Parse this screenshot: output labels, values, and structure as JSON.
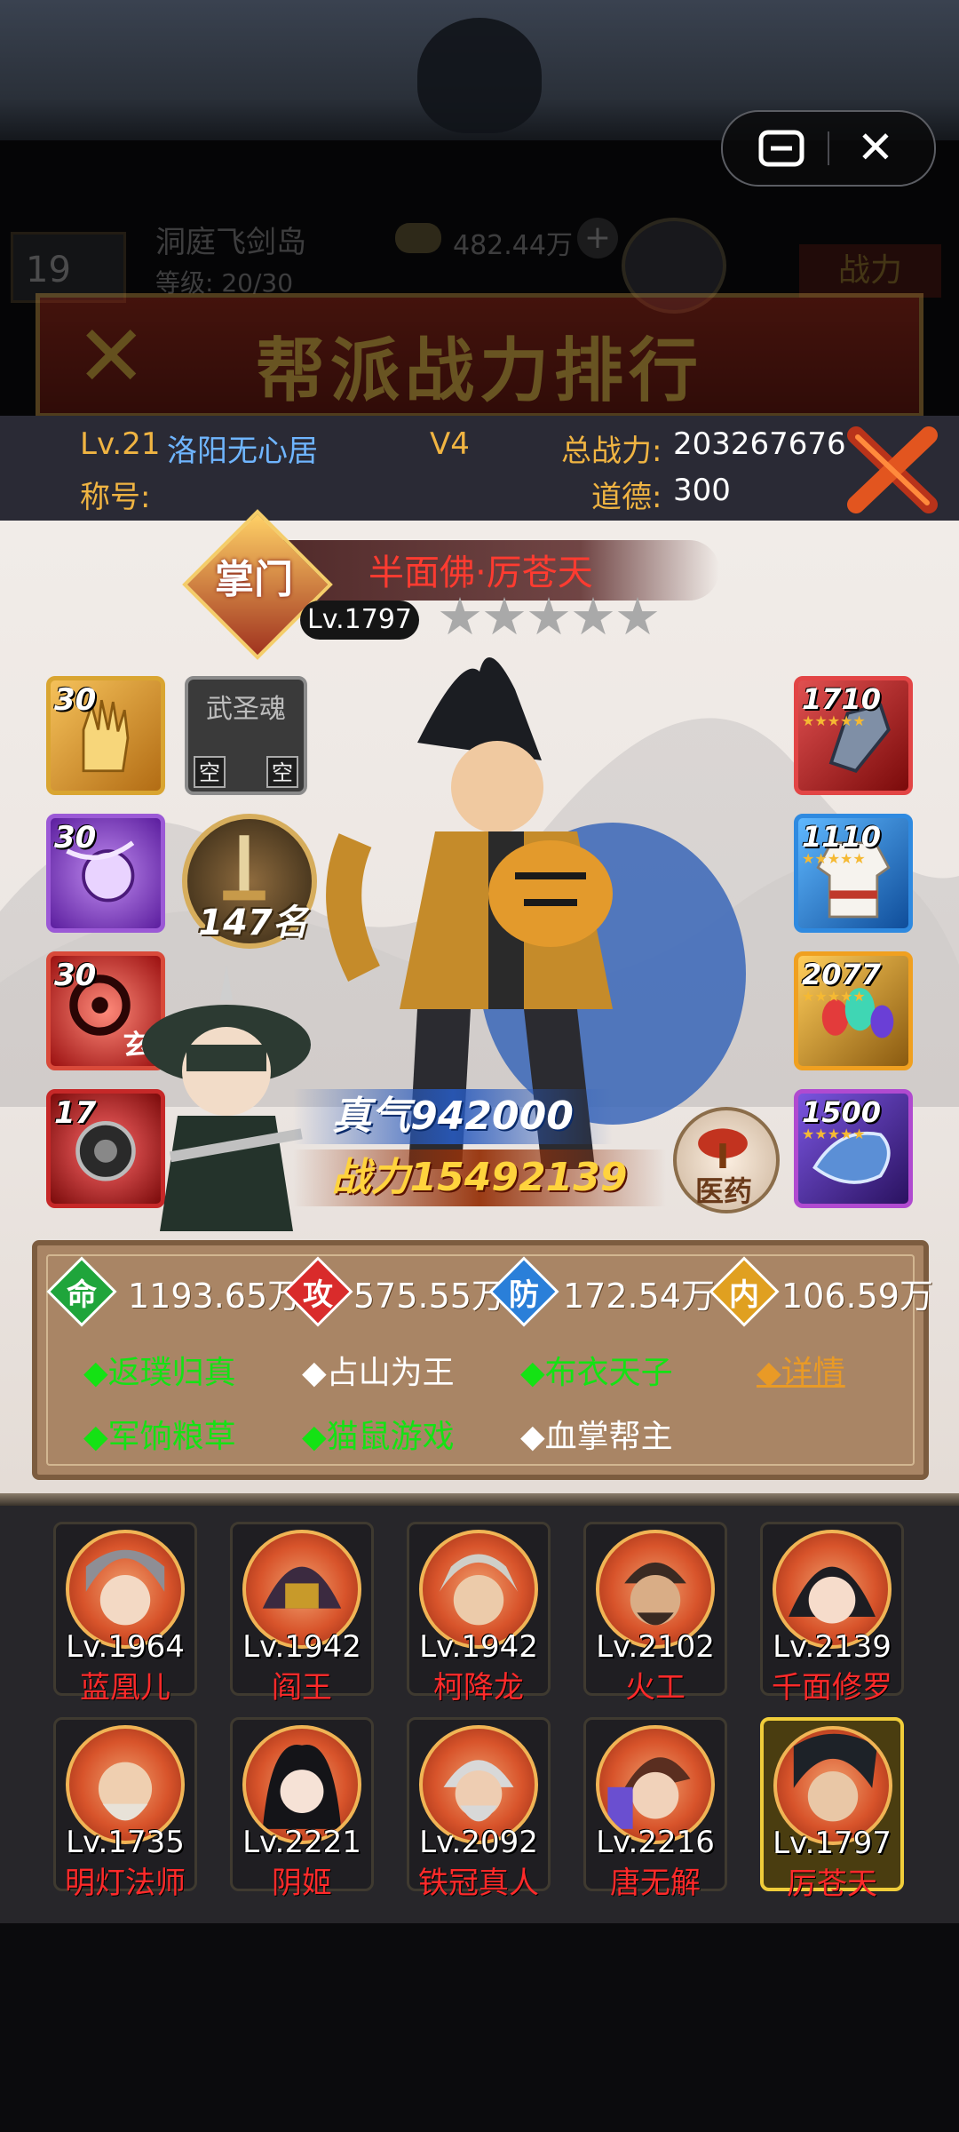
{
  "background": {
    "guild_rank": "19",
    "guild_name": "洞庭飞剑岛",
    "guild_sub": "等级: 20/30",
    "guild_gold": "482.44万",
    "battle_label": "战力",
    "banner_title": "帮派战力排行"
  },
  "player": {
    "level": "Lv.21",
    "name": "洛阳无心居",
    "vip": "V4",
    "total_power_label": "总战力:",
    "total_power": "203267676",
    "title_label": "称号:",
    "morality_label": "道德:",
    "morality": "300"
  },
  "hero": {
    "emblem": "掌门",
    "name": "半面佛·厉苍天",
    "level": "Lv.1797",
    "stars": 5,
    "qi": "真气942000",
    "power": "战力15492139",
    "rank": "147名",
    "medicine": "医药",
    "soul_title": "武圣魂",
    "soul_empty": "空"
  },
  "skills": [
    {
      "num": "30",
      "color": "#e4a12a"
    },
    {
      "num": "30",
      "color": "#8a2be2"
    },
    {
      "num": "30",
      "color": "#c62828",
      "char": "玄"
    },
    {
      "num": "17",
      "color": "#b71c1c"
    }
  ],
  "equipment": [
    {
      "num": "1710",
      "color": "#c62828",
      "icon": "glove-icon"
    },
    {
      "num": "1110",
      "color": "#1e88e5",
      "icon": "robe-icon"
    },
    {
      "num": "2077",
      "color": "#f0a020",
      "icon": "gems-icon"
    },
    {
      "num": "1500",
      "color": "#8e24aa",
      "icon": "beast-icon"
    }
  ],
  "stats": [
    {
      "char": "命",
      "value": "1193.65万",
      "color": "#1fa53b"
    },
    {
      "char": "攻",
      "value": "575.55万",
      "color": "#d92b2b"
    },
    {
      "char": "防",
      "value": "172.54万",
      "color": "#2a7fd9"
    },
    {
      "char": "内",
      "value": "106.59万",
      "color": "#e0a020"
    }
  ],
  "traits_row1": [
    {
      "text": "◆返璞归真",
      "style": "green"
    },
    {
      "text": "◆占山为王",
      "style": "whiteT"
    },
    {
      "text": "◆布衣天子",
      "style": "green"
    },
    {
      "text": "◆详情",
      "style": "orange"
    }
  ],
  "traits_row2": [
    {
      "text": "◆军饷粮草",
      "style": "green"
    },
    {
      "text": "◆猫鼠游戏",
      "style": "green"
    },
    {
      "text": "◆血掌帮主",
      "style": "whiteT"
    }
  ],
  "team": [
    {
      "level": "Lv.1964",
      "name": "蓝凰儿",
      "hair": "#8e8e95"
    },
    {
      "level": "Lv.1942",
      "name": "阎王",
      "hair": "#3b2a40"
    },
    {
      "level": "Lv.1942",
      "name": "柯降龙",
      "hair": "#cfcfc8"
    },
    {
      "level": "Lv.2102",
      "name": "火工",
      "hair": "#3a2a22"
    },
    {
      "level": "Lv.2139",
      "name": "千面修罗",
      "hair": "#1d1d22"
    },
    {
      "level": "Lv.1735",
      "name": "明灯法师",
      "hair": "#e8e2d8"
    },
    {
      "level": "Lv.2221",
      "name": "阴姬",
      "hair": "#141418"
    },
    {
      "level": "Lv.2092",
      "name": "铁冠真人",
      "hair": "#d8d8d8"
    },
    {
      "level": "Lv.2216",
      "name": "唐无解",
      "hair": "#5a2e20"
    },
    {
      "level": "Lv.1797",
      "name": "厉苍天",
      "hair": "#1d2228"
    }
  ],
  "selected_member_index": 9
}
